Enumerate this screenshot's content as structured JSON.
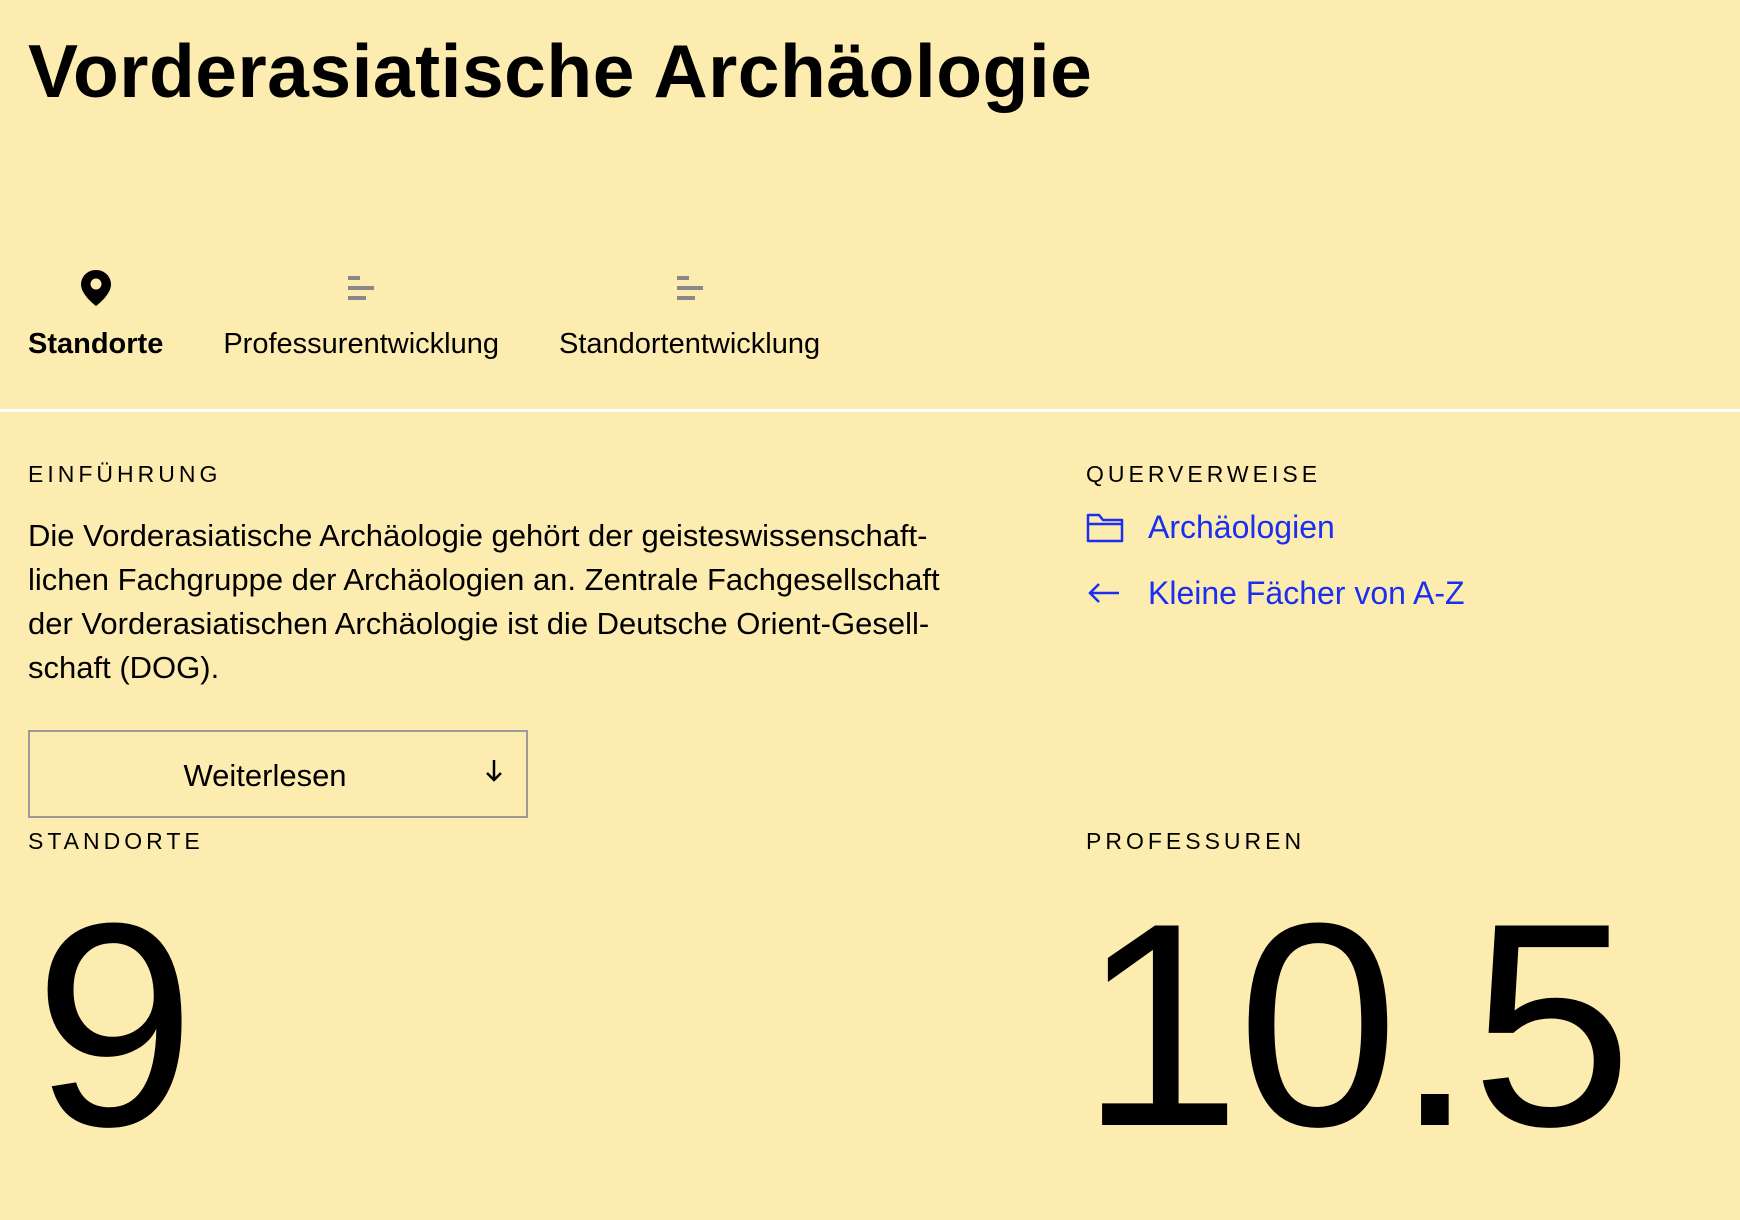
{
  "page": {
    "title": "Vorderasiatische Archäologie",
    "background_color": "#fdecb0",
    "link_color": "#1a2ff0"
  },
  "tabs": [
    {
      "label": "Standorte",
      "icon": "location-pin-icon",
      "active": true
    },
    {
      "label": "Professurentwicklung",
      "icon": "bar-chart-icon",
      "active": false
    },
    {
      "label": "Standortentwicklung",
      "icon": "bar-chart-icon",
      "active": false
    }
  ],
  "intro": {
    "heading": "EINFÜHRUNG",
    "lines": [
      "Die Vorderasiatische Archäologie gehört der geisteswissenschaft-",
      "lichen Fachgruppe der Archäologien an. Zentrale Fachgesellschaft",
      "der Vorderasiatischen Archäologie ist die Deutsche Orient-Gesell-",
      "schaft (DOG)."
    ],
    "read_more_label": "Weiterlesen",
    "read_more_icon": "arrow-down-icon"
  },
  "crossrefs": {
    "heading": "QUERVERWEISE",
    "links": [
      {
        "label": "Archäologien",
        "icon": "folder-icon"
      },
      {
        "label": "Kleine Fächer von A-Z",
        "icon": "arrow-left-icon"
      }
    ]
  },
  "stats": {
    "locations": {
      "label": "STANDORTE",
      "value": "9"
    },
    "professorships": {
      "label": "PROFESSUREN",
      "value": "10.5"
    }
  }
}
